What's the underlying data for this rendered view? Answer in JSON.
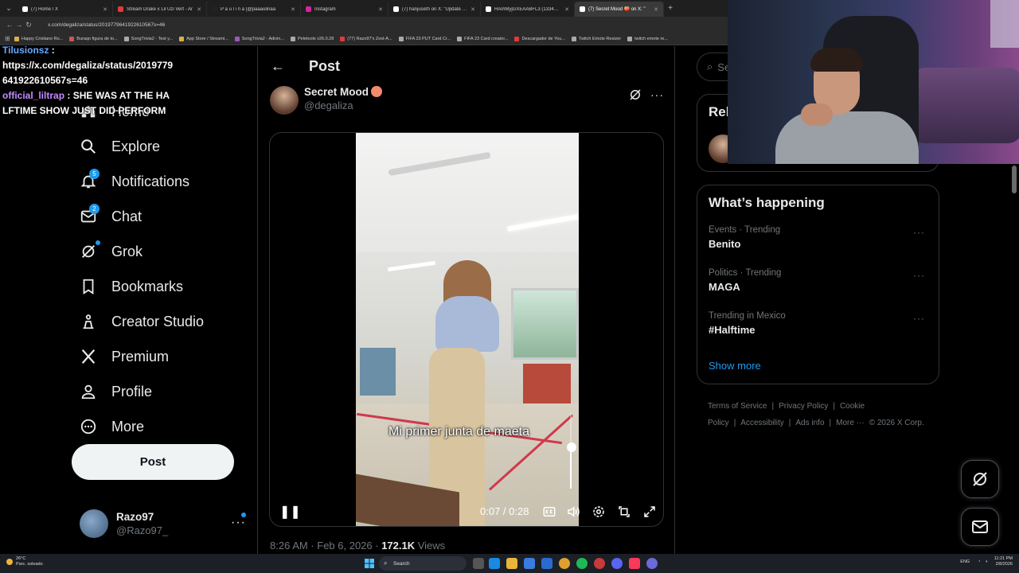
{
  "browser": {
    "tabs": [
      {
        "title": "(7) Home / X",
        "color": "#ffffff",
        "active": false
      },
      {
        "title": "Stream Drake x Lil Uzi Vert - Ar",
        "color": "#e23a3a",
        "active": false
      },
      {
        "title": "P a u l i n a (@paaaulinaa",
        "color": "#222222",
        "active": false
      },
      {
        "title": "Instagram",
        "color": "#d6249f",
        "active": false
      },
      {
        "title": "(7) hanjuseth on X: \"Update ha",
        "color": "#ffffff",
        "active": false
      },
      {
        "title": "HAmMyjGXEAABFL3 (1334×159",
        "color": "#ffffff",
        "active": false
      },
      {
        "title": "(7) Secret Mood 🍑 on X: \"",
        "color": "#ffffff",
        "active": true
      }
    ],
    "new_tab": "+",
    "url": "x.com/degaliza/status/2019779641922610567s=46",
    "bookmarks": [
      {
        "label": "Happy Cristiano Ro...",
        "color": "#d8b04a"
      },
      {
        "label": "Buraqo figura de to...",
        "color": "#cc5555"
      },
      {
        "label": "SongTrivia2 - Test y...",
        "color": "#aaaaaa"
      },
      {
        "label": "App Store / Streami...",
        "color": "#d8b04a"
      },
      {
        "label": "SongTrivia2 - Adivin...",
        "color": "#9b59b6"
      },
      {
        "label": "Peletools v26.0.28",
        "color": "#aaaaaa"
      },
      {
        "label": "(77) Razo97's Zest-A...",
        "color": "#e23a3a"
      },
      {
        "label": "FIFA 23 PUT Card Cr...",
        "color": "#aaaaaa"
      },
      {
        "label": "FIFA 23 Card creator...",
        "color": "#aaaaaa"
      },
      {
        "label": "Descargador de You...",
        "color": "#e23a3a"
      },
      {
        "label": "Twitch Emote Resizer",
        "color": "#aaaaaa"
      },
      {
        "label": "twitch emote re...",
        "color": "#aaaaaa"
      }
    ]
  },
  "chat_overlay": {
    "lines": [
      {
        "user": "Tilusionsz",
        "text": " :",
        "user_color": "blue"
      },
      {
        "user": "",
        "text": "https://x.com/degaliza/status/2019779641922610567s=46",
        "user_color": "blue"
      },
      {
        "user": "official_liltrap",
        "text": " : SHE WAS AT THE HALFTIME SHOW JUST DID PERFORM",
        "user_color": "purple"
      }
    ]
  },
  "nav": {
    "items": [
      {
        "label": "Home",
        "icon": "home-icon",
        "badge": ""
      },
      {
        "label": "Explore",
        "icon": "search-icon",
        "badge": ""
      },
      {
        "label": "Notifications",
        "icon": "bell-icon",
        "badge": "5"
      },
      {
        "label": "Chat",
        "icon": "mail-icon",
        "badge": "2"
      },
      {
        "label": "Grok",
        "icon": "grok-icon",
        "badge": "dot"
      },
      {
        "label": "Bookmarks",
        "icon": "bookmark-icon",
        "badge": ""
      },
      {
        "label": "Creator Studio",
        "icon": "creator-studio-icon",
        "badge": ""
      },
      {
        "label": "Premium",
        "icon": "x-logo-icon",
        "badge": ""
      },
      {
        "label": "Profile",
        "icon": "profile-icon",
        "badge": ""
      },
      {
        "label": "More",
        "icon": "more-circle-icon",
        "badge": ""
      }
    ],
    "post_button": "Post"
  },
  "account": {
    "name": "Razo97",
    "handle": "@Razo97_"
  },
  "main": {
    "title": "Post",
    "author_name": "Secret Mood",
    "author_handle": "@degaliza",
    "video_caption": "Mi primer junta de maeta",
    "time_display": "0:07 / 0:28",
    "volume_level": 0.55,
    "timestamp": "8:26 AM · Feb 6, 2026 · ",
    "views_count": "172.1K",
    "views_label": " Views"
  },
  "right": {
    "search_placeholder": "Se",
    "relevant_title": "Rel",
    "trending_title": "What’s happening",
    "trends": [
      {
        "context": "Events · Trending",
        "name": "Benito"
      },
      {
        "context": "Politics · Trending",
        "name": "MAGA"
      },
      {
        "context": "Trending in Mexico",
        "name": "#Halftime"
      }
    ],
    "show_more": "Show more",
    "footer": [
      "Terms of Service",
      "|",
      "Privacy Policy",
      "|",
      "Cookie Policy",
      "|",
      "Accessibility",
      "|",
      "Ads info",
      "|",
      "More ···",
      "© 2026 X Corp."
    ]
  },
  "taskbar": {
    "weather_temp": "26°C",
    "weather_desc": "Parc. soleado",
    "search_label": "Search",
    "lang": "ENG",
    "time": "11:21 PM",
    "date": "2/8/2026"
  },
  "colors": {
    "accent": "#1d9bf0",
    "background": "#000000",
    "text": "#e7e9ea",
    "muted": "#71767b"
  }
}
